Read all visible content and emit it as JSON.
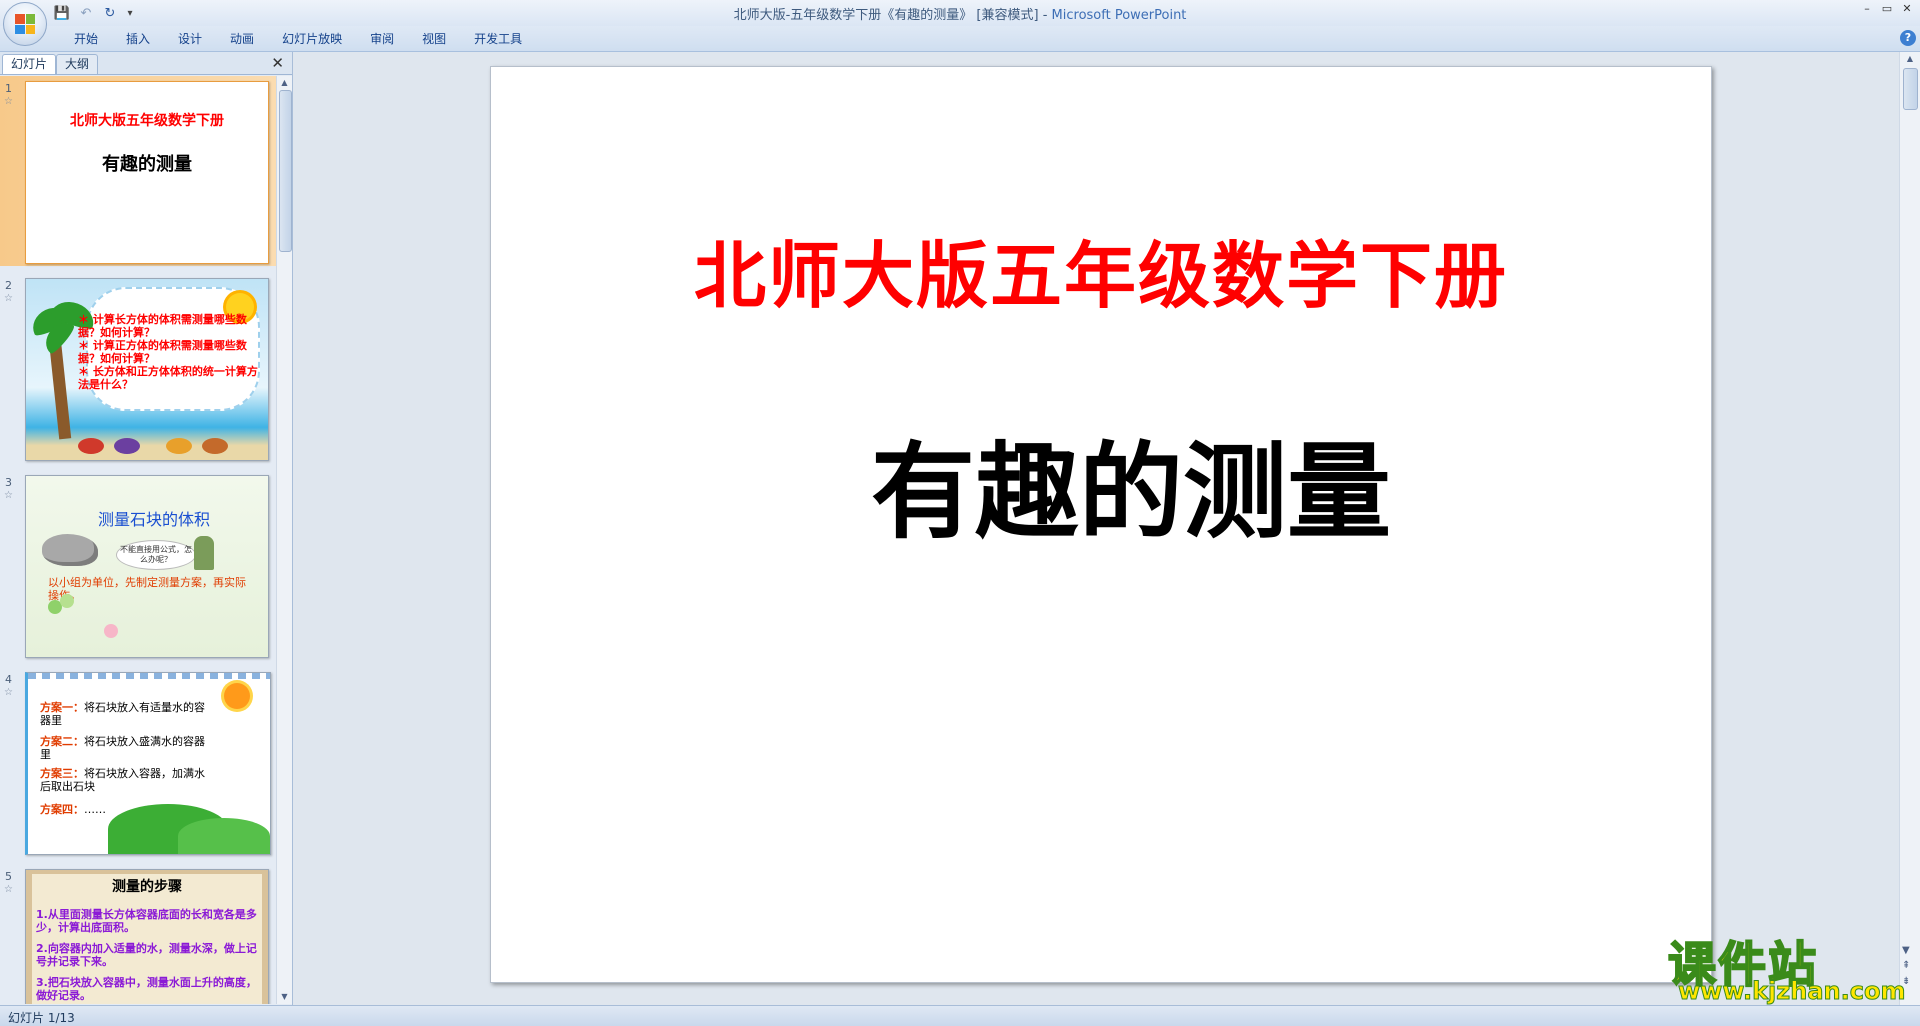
{
  "window": {
    "title_main": "北师大版-五年级数学下册《有趣的测量》 [兼容模式] - ",
    "title_app": "Microsoft PowerPoint",
    "controls": [
      "–",
      "▭",
      "✕"
    ]
  },
  "qat": {
    "save": "💾",
    "undo": "↶",
    "redo": "↻",
    "customize": "▾"
  },
  "ribbon": {
    "tabs": [
      "开始",
      "插入",
      "设计",
      "动画",
      "幻灯片放映",
      "审阅",
      "视图",
      "开发工具"
    ],
    "help": "?"
  },
  "left_pane": {
    "tab_slides": "幻灯片",
    "tab_outline": "大纲",
    "close": "✕",
    "thumbnails": [
      {
        "number": "1",
        "title": "北师大版五年级数学下册",
        "subtitle": "有趣的测量"
      },
      {
        "number": "2",
        "lines": [
          "＊ 计算长方体的体积需测量哪些数据？如何计算？",
          "＊ 计算正方体的体积需测量哪些数据？如何计算？",
          "＊ 长方体和正方体体积的统一计算方法是什么？"
        ]
      },
      {
        "number": "3",
        "title": "测量石块的体积",
        "bubble": "不能直接用公式，怎么办呢？",
        "text": "以小组为单位，先制定测量方案，再实际操作。"
      },
      {
        "number": "4",
        "lines": [
          {
            "label": "方案一：",
            "text": "将石块放入有适量水的容器里"
          },
          {
            "label": "方案二：",
            "text": "将石块放入盛满水的容器里"
          },
          {
            "label": "方案三：",
            "text": "将石块放入容器，加满水后取出石块"
          },
          {
            "label": "方案四：",
            "text": "……"
          }
        ]
      },
      {
        "number": "5",
        "title": "测量的步骤",
        "lines": [
          "1.从里面测量长方体容器底面的长和宽各是多少，计算出底面积。",
          "2.向容器内加入适量的水，测量水深，做上记号并记录下来。",
          "3.把石块放入容器中，测量水面上升的高度，做好记录。"
        ]
      }
    ]
  },
  "slide": {
    "title": "北师大版五年级数学下册",
    "subtitle": "有趣的测量"
  },
  "status": {
    "text": "幻灯片 1/13"
  },
  "watermark": {
    "brand": "课件站",
    "url": "www.kjzhan.com"
  },
  "colors": {
    "title_red": "#ff0000",
    "accent_blue": "#15428b",
    "selected_thumb": "#f7c98a"
  }
}
